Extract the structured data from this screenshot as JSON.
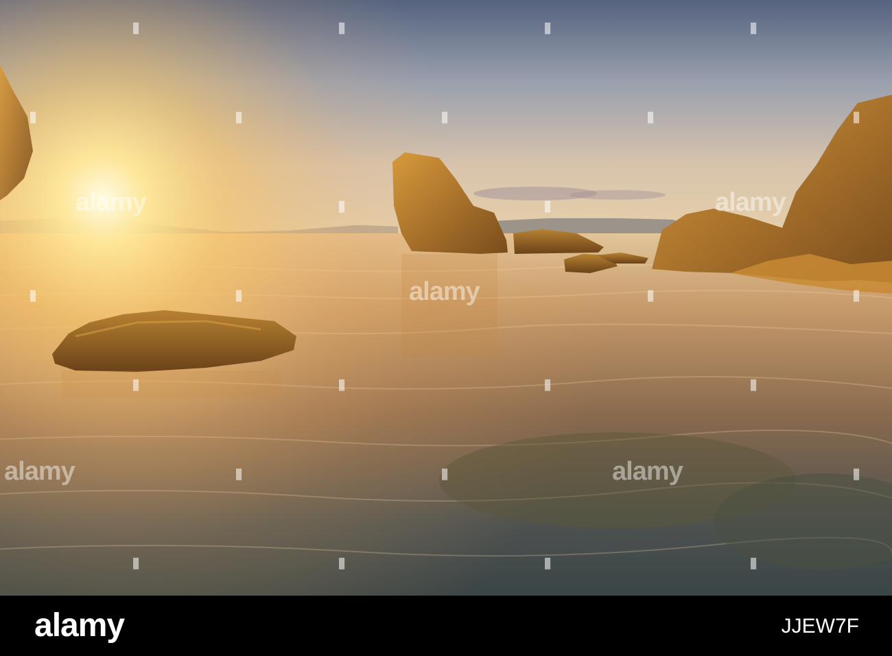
{
  "scene": {
    "description_colors": {
      "sky_top": "#5d6a86",
      "sky_mid": "#c9b4a0",
      "sun_glow": "#fff6c8",
      "sea_far": "#d8b892",
      "sea_near": "#3e4a4c",
      "rock": "#8a5a22",
      "rock_light": "#d89a3a"
    }
  },
  "watermark": {
    "word": "alamy",
    "glyph": "▮"
  },
  "footer": {
    "logo": "alamy",
    "image_id": "JJEW7F"
  }
}
